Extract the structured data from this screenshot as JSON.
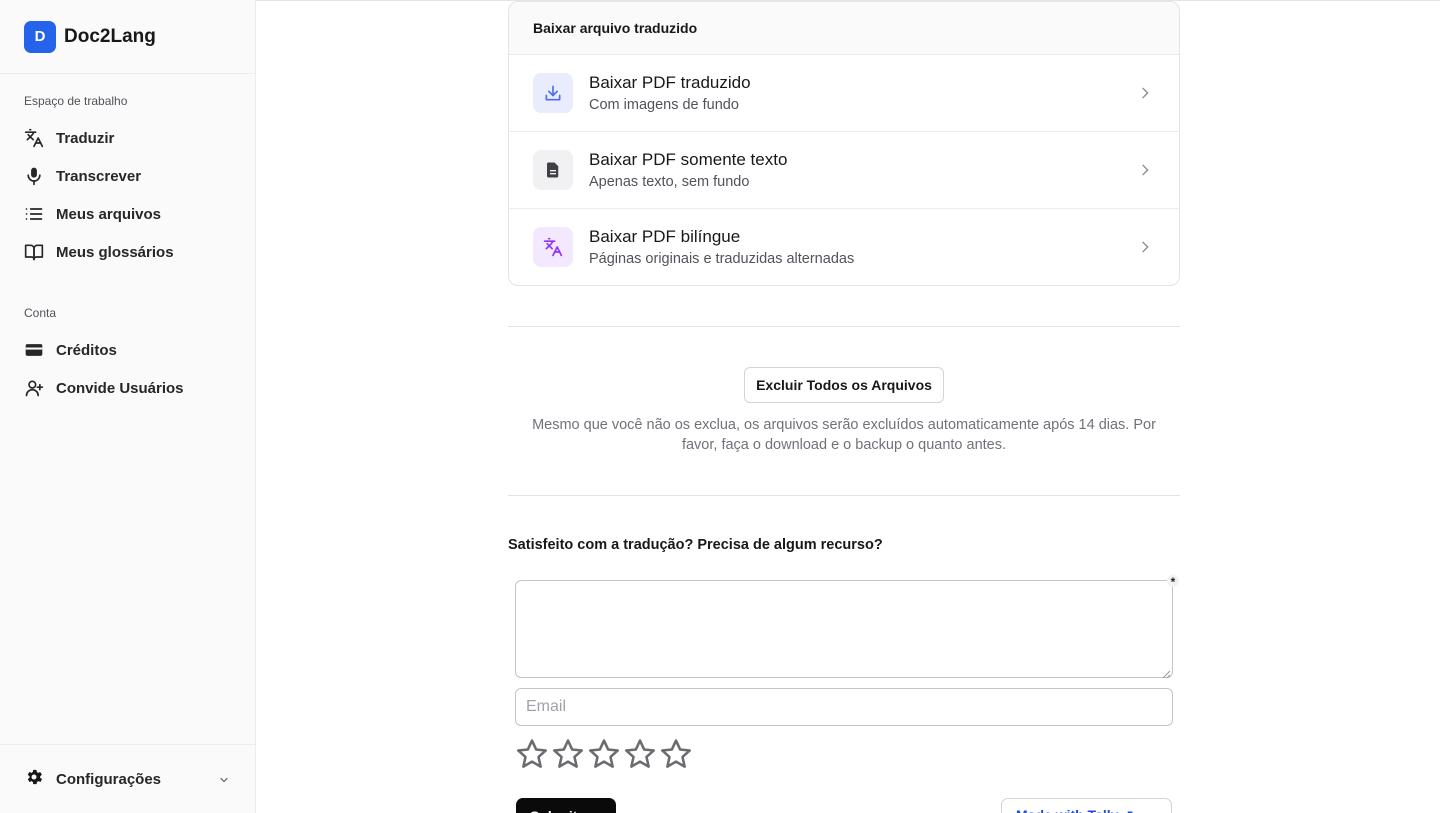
{
  "app": {
    "logo_letter": "D",
    "name": "Doc2Lang",
    "brand_color": "#2563eb"
  },
  "sidebar": {
    "workspace_label": "Espaço de trabalho",
    "workspace_items": [
      {
        "label": "Traduzir",
        "icon": "translate-icon"
      },
      {
        "label": "Transcrever",
        "icon": "microphone-icon"
      },
      {
        "label": "Meus arquivos",
        "icon": "list-icon"
      },
      {
        "label": "Meus glossários",
        "icon": "book-icon"
      }
    ],
    "account_label": "Conta",
    "account_items": [
      {
        "label": "Créditos",
        "icon": "credit-card-icon"
      },
      {
        "label": "Convide Usuários",
        "icon": "user-plus-icon"
      }
    ],
    "settings_label": "Configurações"
  },
  "download": {
    "header": "Baixar arquivo traduzido",
    "options": [
      {
        "title": "Baixar PDF traduzido",
        "subtitle": "Com imagens de fundo",
        "icon": "download-icon",
        "icon_bg": "#e8ecfd",
        "icon_color": "#4f6bed"
      },
      {
        "title": "Baixar PDF somente texto",
        "subtitle": "Apenas texto, sem fundo",
        "icon": "document-icon",
        "icon_bg": "#f1f1f3",
        "icon_color": "#3f3f46"
      },
      {
        "title": "Baixar PDF bilíngue",
        "subtitle": "Páginas originais e traduzidas alternadas",
        "icon": "translate-icon",
        "icon_bg": "#f3e8fd",
        "icon_color": "#9333ea"
      }
    ]
  },
  "delete": {
    "button_label": "Excluir Todos os Arquivos",
    "note_line1": "Mesmo que você não os exclua, os arquivos serão excluídos automaticamente após 14 dias. Por",
    "note_line2": "favor, faça o download e o backup o quanto antes."
  },
  "feedback": {
    "question": "Satisfeito com a tradução? Precisa de algum recurso?",
    "textarea_value": "",
    "required_mark": "*",
    "email_placeholder": "Email",
    "rating": 0,
    "rating_max": 5,
    "submit_label": "Submit →",
    "made_with_label": "Made with Tally ↗"
  }
}
